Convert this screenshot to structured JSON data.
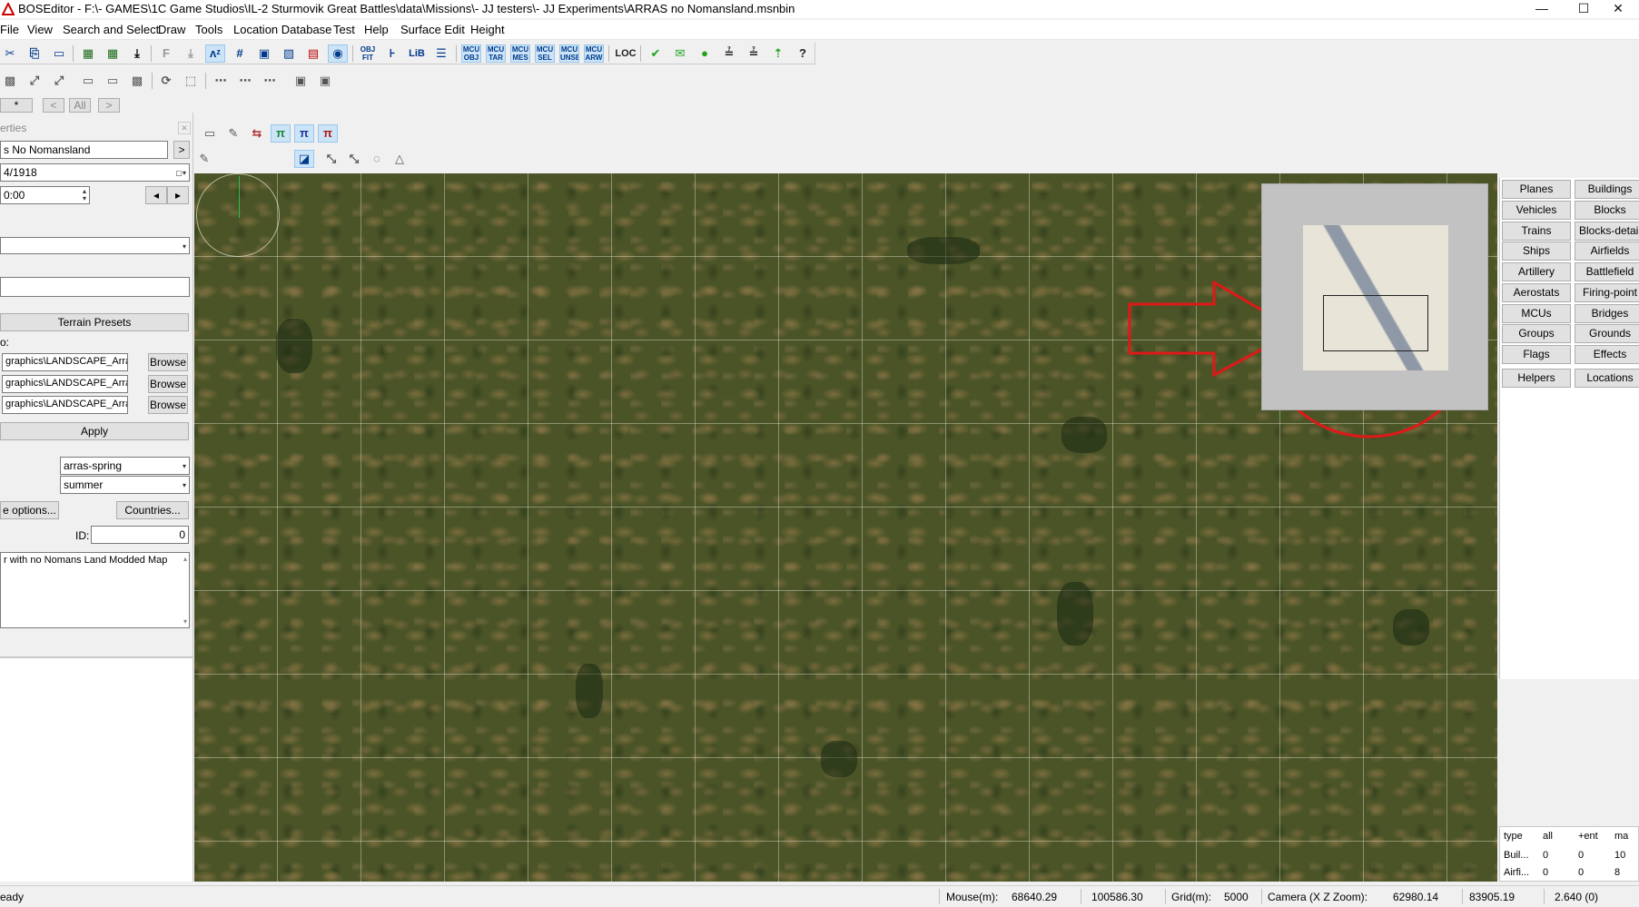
{
  "window": {
    "title": "BOSEditor - F:\\- GAMES\\1C Game Studios\\IL-2 Sturmovik Great Battles\\data\\Missions\\- JJ testers\\- JJ Experiments\\ARRAS no Nomansland.msnbin",
    "minimize": "—",
    "maximize": "☐",
    "close": "✕"
  },
  "menu": [
    "File",
    "View",
    "Search and Select",
    "Draw",
    "Tools",
    "Location Database",
    "Test",
    "Help",
    "Surface Edit",
    "Height"
  ],
  "toolbar1": {
    "buttons": [
      "✂",
      "⎘",
      "▭",
      "▦",
      "▦",
      "⤓",
      "F",
      "⤓",
      "ʌᶻ",
      "#",
      "▣",
      "▨",
      "▤",
      "◉",
      "OBJ FIT",
      "⊦",
      "LiB",
      "☰",
      "MCU OBJ",
      "MCU TAR",
      "MCU MES",
      "MCU SEL",
      "MCU UNSE",
      "MCU ARW",
      "LOC",
      "✔",
      "✉",
      "●",
      "≟",
      "≟",
      "⇡",
      "?"
    ]
  },
  "toolbar2": {
    "buttons": [
      "▩",
      "⤢",
      "⤢",
      "▭",
      "▭",
      "▩",
      "⟳",
      "⬚",
      "⋯",
      "⋯",
      "⋯",
      "▣",
      "▣"
    ]
  },
  "toolbar3": {
    "tab_star": "*",
    "prev": "<",
    "all": "All",
    "next": ">",
    "buttons": [
      "▭",
      "✎",
      "⇆",
      "π",
      "π",
      "π"
    ]
  },
  "toolbar4": {
    "buttons": [
      "✎",
      "◪",
      "⤡",
      "⤡",
      "◌",
      "△"
    ]
  },
  "properties": {
    "title": "erties",
    "name_value": "s No Nomansland",
    "name_btn": ">",
    "date_value": "4/1918",
    "time_value": "0:00",
    "prev_btn": "◂",
    "next_btn": "▸",
    "terrain_presets": "Terrain Presets",
    "path_label": "o:",
    "paths": [
      "graphics\\LANDSCAPE_Arras",
      "graphics\\LANDSCAPE_Arras",
      "graphics\\LANDSCAPE_Arras"
    ],
    "browse": "Browse",
    "apply": "Apply",
    "season_1": "arras-spring",
    "season_2": "summer",
    "options_btn": "e options...",
    "countries_btn": "Countries...",
    "id_label": "ID:",
    "id_value": "0",
    "description": "r with no Nomans Land Modded Map"
  },
  "object_buttons": {
    "left": [
      "Planes",
      "Vehicles",
      "Trains",
      "Ships",
      "Artillery",
      "Aerostats",
      "MCUs",
      "Groups",
      "Flags",
      "Helpers"
    ],
    "right": [
      "Buildings",
      "Blocks",
      "Blocks-detail",
      "Airfields",
      "Battlefield",
      "Firing-point",
      "Bridges",
      "Grounds",
      "Effects",
      "Locations"
    ]
  },
  "stats_table": {
    "headers": [
      "type",
      "all",
      "+ent",
      "ma"
    ],
    "rows": [
      [
        "Buil...",
        "0",
        "0",
        "10"
      ],
      [
        "Airfi...",
        "0",
        "0",
        "8"
      ]
    ]
  },
  "status": {
    "ready": "eady",
    "mouse_label": "Mouse(m):",
    "mouse_x": "68640.29",
    "mouse_z": "100586.30",
    "grid_label": "Grid(m):",
    "grid_value": "5000",
    "camera_label": "Camera (X Z Zoom):",
    "camera_x": "62980.14",
    "camera_z": "83905.19",
    "camera_zoom": "2.640 (0)"
  }
}
